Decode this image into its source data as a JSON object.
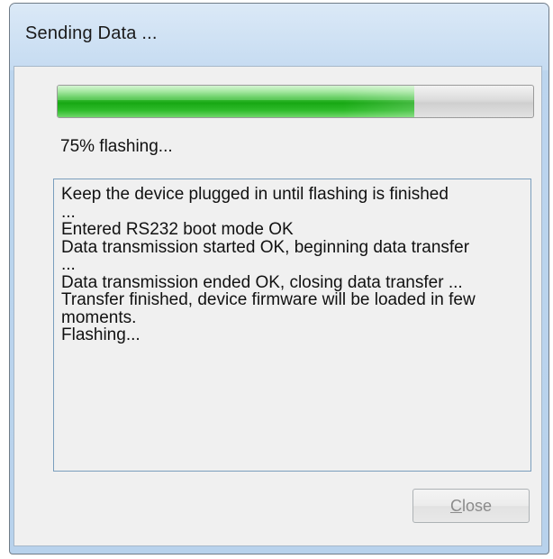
{
  "window": {
    "title": "Sending Data ..."
  },
  "progress": {
    "percent": 75,
    "status_text": "75% flashing...",
    "fill_color": "#18a814"
  },
  "log": {
    "lines": [
      "Keep the device plugged in until flashing is finished",
      "...",
      "Entered RS232 boot mode OK",
      "Data transmission started OK, beginning data transfer",
      "...",
      "Data transmission ended OK, closing data transfer ...",
      "Transfer finished, device firmware will be loaded in few",
      "moments.",
      "Flashing..."
    ]
  },
  "buttons": {
    "close": {
      "mnemonic": "C",
      "rest": "lose",
      "enabled": false
    }
  }
}
